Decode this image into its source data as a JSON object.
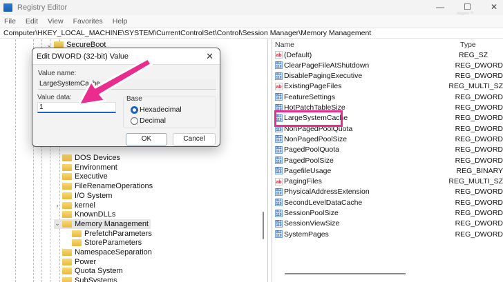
{
  "window": {
    "title": "Registry Editor",
    "minimize": "—",
    "maximize": "☐",
    "close": "✕"
  },
  "menu": [
    "File",
    "Edit",
    "View",
    "Favorites",
    "Help"
  ],
  "address": "Computer\\HKEY_LOCAL_MACHINE\\SYSTEM\\CurrentControlSet\\Control\\Session Manager\\Memory Management",
  "tree": [
    {
      "label": "SecureBoot",
      "chev": "⌄"
    },
    {
      "label": "DOS Devices",
      "chev": ""
    },
    {
      "label": "Environment",
      "chev": ""
    },
    {
      "label": "Executive",
      "chev": ""
    },
    {
      "label": "FileRenameOperations",
      "chev": ""
    },
    {
      "label": "I/O System",
      "chev": ""
    },
    {
      "label": "kernel",
      "chev": "›"
    },
    {
      "label": "KnownDLLs",
      "chev": ""
    },
    {
      "label": "Memory Management",
      "chev": "⌄"
    },
    {
      "label": "PrefetchParameters",
      "chev": ""
    },
    {
      "label": "StoreParameters",
      "chev": ""
    },
    {
      "label": "NamespaceSeparation",
      "chev": ""
    },
    {
      "label": "Power",
      "chev": ""
    },
    {
      "label": "Quota System",
      "chev": ""
    },
    {
      "label": "SubSystems",
      "chev": ""
    }
  ],
  "list": {
    "headers": {
      "name": "Name",
      "type": "Type"
    },
    "rows": [
      {
        "name": "(Default)",
        "type": "REG_SZ",
        "icon": "ab"
      },
      {
        "name": "ClearPageFileAtShutdown",
        "type": "REG_DWORD",
        "icon": "bin"
      },
      {
        "name": "DisablePagingExecutive",
        "type": "REG_DWORD",
        "icon": "bin"
      },
      {
        "name": "ExistingPageFiles",
        "type": "REG_MULTI_SZ",
        "icon": "ab"
      },
      {
        "name": "FeatureSettings",
        "type": "REG_DWORD",
        "icon": "bin"
      },
      {
        "name": "HotPatchTableSize",
        "type": "REG_DWORD",
        "icon": "bin"
      },
      {
        "name": "LargeSystemCache",
        "type": "REG_DWORD",
        "icon": "bin"
      },
      {
        "name": "NonPagedPoolQuota",
        "type": "REG_DWORD",
        "icon": "bin"
      },
      {
        "name": "NonPagedPoolSize",
        "type": "REG_DWORD",
        "icon": "bin"
      },
      {
        "name": "PagedPoolQuota",
        "type": "REG_DWORD",
        "icon": "bin"
      },
      {
        "name": "PagedPoolSize",
        "type": "REG_DWORD",
        "icon": "bin"
      },
      {
        "name": "PagefileUsage",
        "type": "REG_BINARY",
        "icon": "bin"
      },
      {
        "name": "PagingFiles",
        "type": "REG_MULTI_SZ",
        "icon": "ab"
      },
      {
        "name": "PhysicalAddressExtension",
        "type": "REG_DWORD",
        "icon": "bin"
      },
      {
        "name": "SecondLevelDataCache",
        "type": "REG_DWORD",
        "icon": "bin"
      },
      {
        "name": "SessionPoolSize",
        "type": "REG_DWORD",
        "icon": "bin"
      },
      {
        "name": "SessionViewSize",
        "type": "REG_DWORD",
        "icon": "bin"
      },
      {
        "name": "SystemPages",
        "type": "REG_DWORD",
        "icon": "bin"
      }
    ]
  },
  "dialog": {
    "title": "Edit DWORD (32-bit) Value",
    "close": "✕",
    "value_name_label": "Value name:",
    "value_name": "LargeSystemCache",
    "value_data_label": "Value data:",
    "value_data": "1",
    "base_label": "Base",
    "hex": "Hexadecimal",
    "dec": "Decimal",
    "base_selected": "Hexadecimal",
    "ok": "OK",
    "cancel": "Cancel"
  },
  "watermark": "Tips",
  "colors": {
    "highlight": "#ea2c8e",
    "accent": "#1f63b9"
  }
}
